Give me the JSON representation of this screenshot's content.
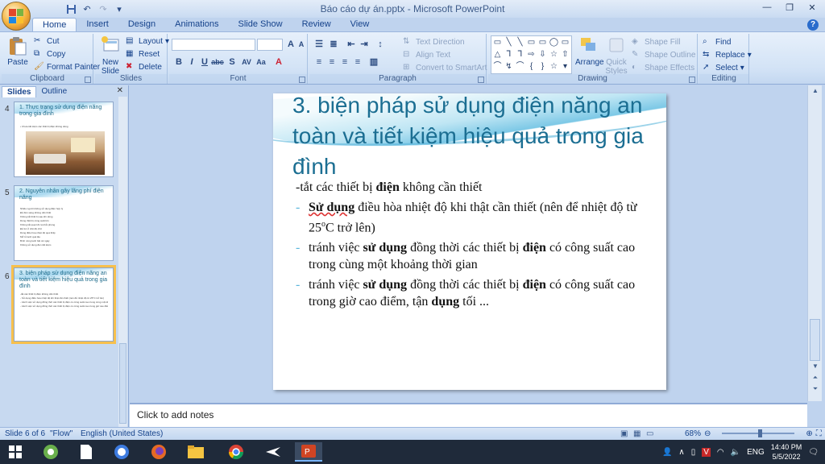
{
  "window": {
    "title": "Báo cáo dự án.pptx - Microsoft PowerPoint"
  },
  "quick_access": {
    "save_icon": "save-icon",
    "undo_icon": "undo-icon",
    "redo_icon": "redo-icon"
  },
  "tabs": [
    {
      "label": "Home",
      "active": true
    },
    {
      "label": "Insert"
    },
    {
      "label": "Design"
    },
    {
      "label": "Animations"
    },
    {
      "label": "Slide Show"
    },
    {
      "label": "Review"
    },
    {
      "label": "View"
    }
  ],
  "ribbon": {
    "clipboard": {
      "label": "Clipboard",
      "paste": "Paste",
      "cut": "Cut",
      "copy": "Copy",
      "format_painter": "Format Painter"
    },
    "slides": {
      "label": "Slides",
      "new_slide": "New Slide",
      "layout": "Layout",
      "reset": "Reset",
      "delete": "Delete"
    },
    "font": {
      "label": "Font"
    },
    "paragraph": {
      "label": "Paragraph",
      "text_direction": "Text Direction",
      "align_text": "Align Text",
      "convert_smartart": "Convert to SmartArt"
    },
    "drawing": {
      "label": "Drawing",
      "arrange": "Arrange",
      "quick_styles": "Quick Styles",
      "shape_fill": "Shape Fill",
      "shape_outline": "Shape Outline",
      "shape_effects": "Shape Effects"
    },
    "editing": {
      "label": "Editing",
      "find": "Find",
      "replace": "Replace",
      "select": "Select"
    }
  },
  "panel": {
    "tab_slides": "Slides",
    "tab_outline": "Outline",
    "thumbnails": [
      {
        "num": "4",
        "title": "1. Thực trạng sử dụng điện năng trong gia đình",
        "lines": [
          "• Chưa tiết kiệm các thiết bị điện không dùng"
        ]
      },
      {
        "num": "5",
        "title": "2. Nguyên nhân gây lãng phí điện năng",
        "lines": [
          "Nhiều người không sử dụng điện hợp lý",
          "Để đèn sáng không cần thiết",
          "Không tắt thiết bị sau khi dùng",
          "Dùng thiết bị công suất lớn",
          "Không tắt quạt khi ra khỏi phòng",
          "Để tivi ở chế độ chờ",
          "Dùng điều hòa nhiệt độ quá thấp",
          "Mở tủ lạnh quá lâu",
          "Bình nóng lạnh bật cả ngày",
          "Không sử dụng đèn tiết kiệm"
        ]
      },
      {
        "num": "6",
        "title": "3. biện pháp sử dụng điện năng an toàn và tiết kiệm hiệu quả trong gia đình",
        "lines": [
          "-tắt các thiết bị điện không cần thiết",
          "- Sử dụng điều hòa nhiệt độ khi thật cần thiết (nên để nhiệt độ từ 25°C trở lên)",
          "- tránh việc sử dụng đồng thời các thiết bị điện có công suất cao trong cùng một khoảng thời gian",
          "- tránh việc sử dụng đồng thời các thiết bị điện có công suất cao trong giờ cao điểm, tận dụng tối ..."
        ]
      }
    ]
  },
  "slide": {
    "title": "3. biện pháp sử dụng điện năng an toàn và tiết kiệm hiệu quả trong gia đình",
    "line1_a": "-tắt các thiết bị ",
    "line1_b": "điện",
    "line1_c": " không cần thiết",
    "b1_a": "Sử dụng",
    "b1_b": " điều hòa nhiệt độ khi thật cần thiết (nên để nhiệt độ từ 25",
    "b1_sup": "o",
    "b1_c": "C trở lên)",
    "b2_a": "tránh việc ",
    "b2_b": "sử dụng",
    "b2_c": " đồng thời các thiết bị ",
    "b2_d": "điện",
    "b2_e": " có công suất cao trong cùng một khoảng thời gian",
    "b3_a": "tránh việc ",
    "b3_b": "sử dụng",
    "b3_c": " đồng thời các thiết bị ",
    "b3_d": "điện",
    "b3_e": " có công suất cao trong giờ cao điểm, tận ",
    "b3_f": "dụng",
    "b3_g": " tối ...",
    "bullet_dash": "-"
  },
  "notes": {
    "placeholder": "Click to add notes"
  },
  "status": {
    "slide_info": "Slide 6 of 6",
    "theme": "\"Flow\"",
    "language": "English (United States)",
    "zoom": "68%",
    "zoom_level": 0.68
  },
  "taskbar": {
    "language": "ENG",
    "time": "14:40 PM",
    "date": "5/5/2022"
  }
}
